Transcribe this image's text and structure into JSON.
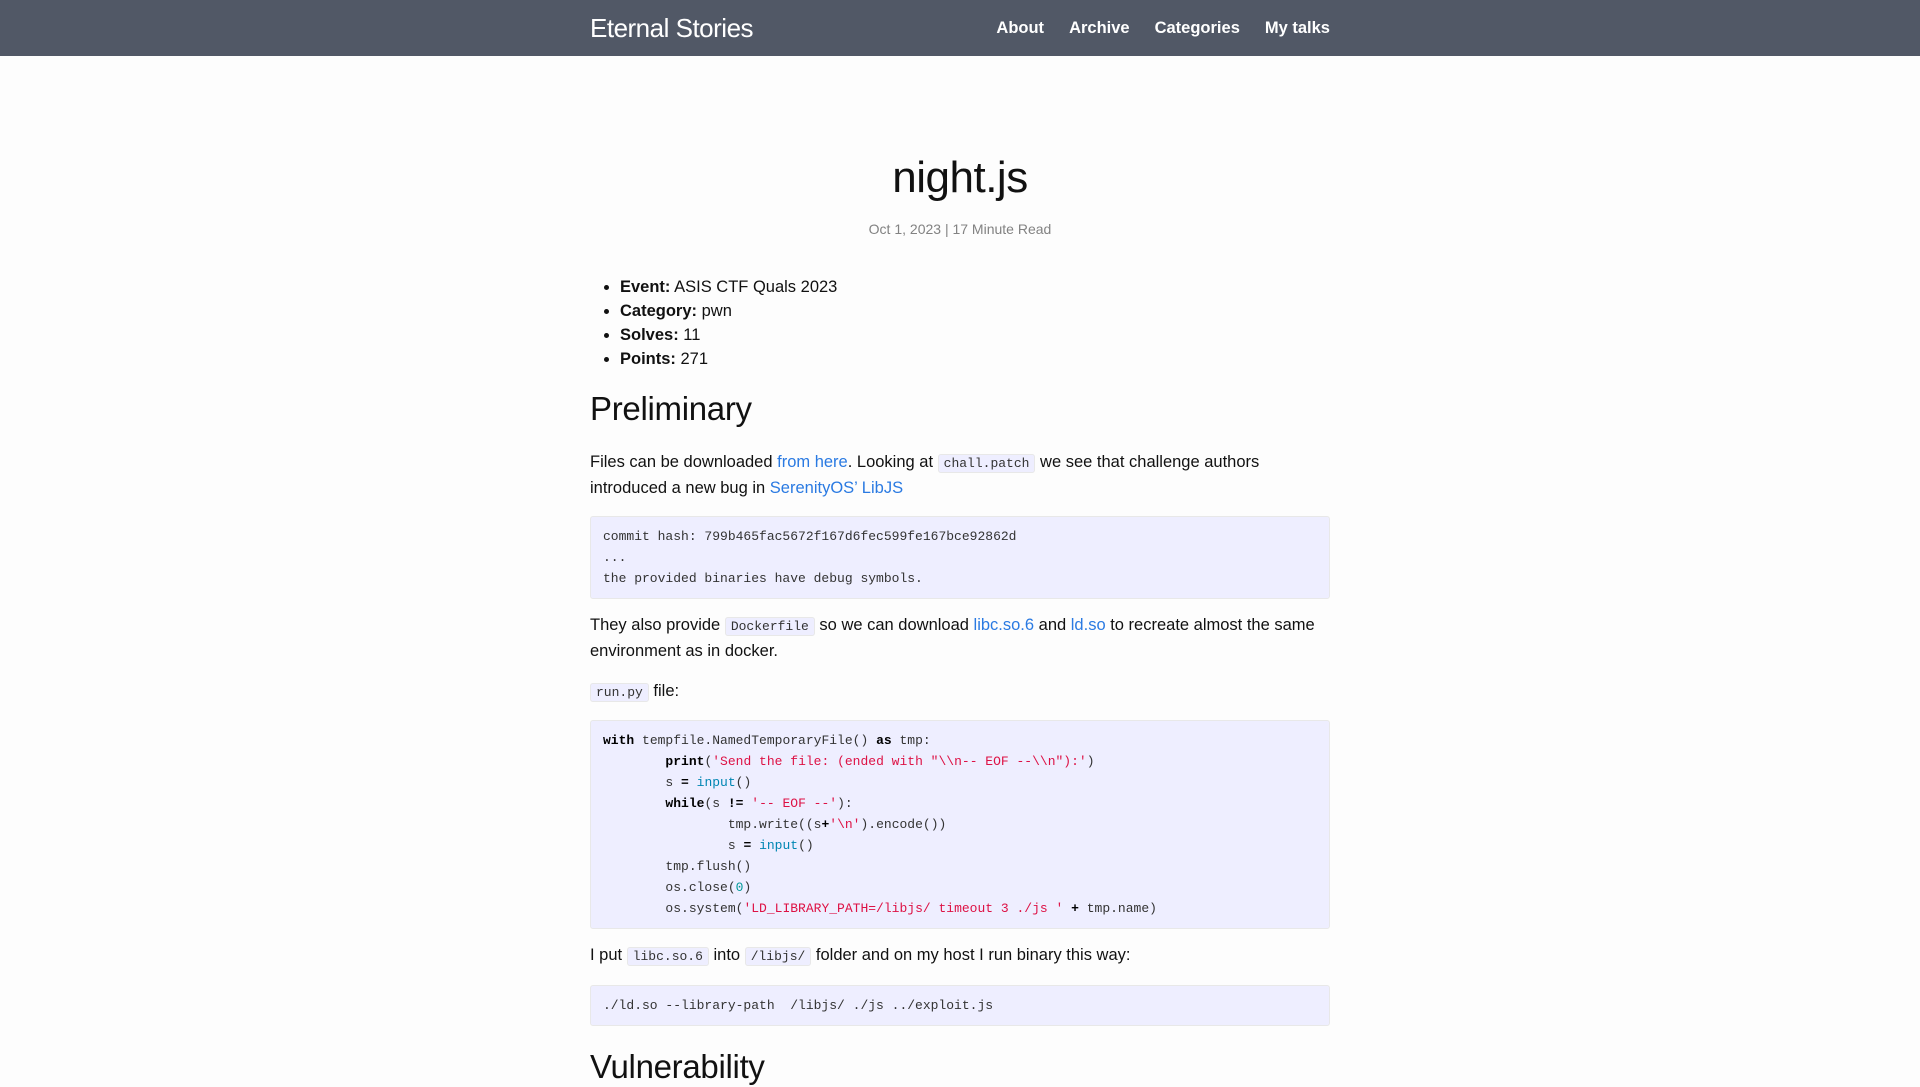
{
  "header": {
    "site_title": "Eternal Stories",
    "nav": [
      "About",
      "Archive",
      "Categories",
      "My talks"
    ]
  },
  "post": {
    "title": "night.js",
    "meta": "Oct 1, 2023 | 17 Minute Read",
    "info": [
      {
        "label": "Event:",
        "value": " ASIS CTF Quals 2023"
      },
      {
        "label": "Category:",
        "value": " pwn"
      },
      {
        "label": "Solves:",
        "value": " 11"
      },
      {
        "label": "Points:",
        "value": " 271"
      }
    ],
    "sections": {
      "preliminary": {
        "heading": "Preliminary",
        "p1": {
          "t1": "Files can be downloaded ",
          "link1": "from here",
          "t2": ". Looking at ",
          "code1": "chall.patch",
          "t3": " we see that challenge authors introduced a new bug in ",
          "link2": "SerenityOS’ LibJS"
        },
        "code_block_1": [
          "commit hash: 799b465fac5672f167d6fec599fe167bce92862d",
          "...",
          "the provided binaries have debug symbols."
        ],
        "p2": {
          "t1": "They also provide ",
          "code1": "Dockerfile",
          "t2": " so we can download ",
          "link1": "libc.so.6",
          "t3": " and ",
          "link2": "ld.so",
          "t4": " to recreate almost the same environment as in docker."
        },
        "p3": {
          "code1": "run.py",
          "t1": " file:"
        },
        "code_block_2": {
          "l1_kw1": "with",
          "l1_t1": " tempfile.NamedTemporaryFile() ",
          "l1_kw2": "as",
          "l1_t2": " tmp:",
          "l2_kw": "print",
          "l2_t1": "(",
          "l2_str": "'Send the file: (ended with \"\\\\n-- EOF --\\\\n\"):'",
          "l2_t2": ")",
          "l3_t1": "s ",
          "l3_op": "=",
          "l3_t2": " ",
          "l3_bi": "input",
          "l3_t3": "()",
          "l4_kw": "while",
          "l4_t1": "(s ",
          "l4_op": "!=",
          "l4_t2": " ",
          "l4_str": "'-- EOF --'",
          "l4_t3": "):",
          "l5_t1": "tmp.write((s",
          "l5_op": "+",
          "l5_str": "'\\n'",
          "l5_t2": ").encode())",
          "l6_t1": "s ",
          "l6_op": "=",
          "l6_t2": " ",
          "l6_bi": "input",
          "l6_t3": "()",
          "l7": "tmp.flush()",
          "l8_t1": "os.close(",
          "l8_num": "0",
          "l8_t2": ")",
          "l9_t1": "os.system(",
          "l9_str": "'LD_LIBRARY_PATH=/libjs/ timeout 3 ./js '",
          "l9_t2": " ",
          "l9_op": "+",
          "l9_t3": " tmp.name)"
        },
        "p4": {
          "t1": "I put ",
          "code1": "libc.so.6",
          "t2": " into ",
          "code2": "/libjs/",
          "t3": " folder and on my host I run binary this way:"
        },
        "code_block_3": "./ld.so --library-path  /libjs/ ./js ../exploit.js"
      },
      "vulnerability": {
        "heading": "Vulnerability"
      }
    }
  }
}
